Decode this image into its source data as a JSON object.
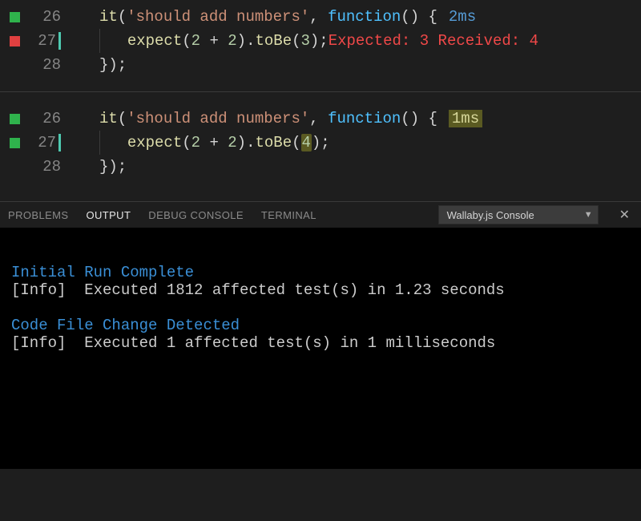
{
  "pane1": {
    "lines": [
      {
        "num": "26",
        "marker": "pass"
      },
      {
        "num": "27",
        "marker": "fail",
        "cursor": true
      },
      {
        "num": "28"
      }
    ],
    "code": {
      "it": "it",
      "testName": "'should add numbers'",
      "comma": ", ",
      "fn": "function",
      "fnTail": "() {",
      "time": "2ms",
      "expect": "expect",
      "expOpen": "(",
      "n1": "2",
      "plus": " + ",
      "n2": "2",
      "expClose": ").",
      "toBe": "toBe",
      "tbOpen": "(",
      "arg": "3",
      "tbClose": ");",
      "err1": "Expected: ",
      "errE": "3",
      "err2": " Received: ",
      "errR": "4",
      "close": "});"
    }
  },
  "pane2": {
    "lines": [
      {
        "num": "26",
        "marker": "pass"
      },
      {
        "num": "27",
        "marker": "pass",
        "cursor": true
      },
      {
        "num": "28"
      }
    ],
    "code": {
      "it": "it",
      "testName": "'should add numbers'",
      "comma": ", ",
      "fn": "function",
      "fnTail": "() {",
      "time": "1ms",
      "expect": "expect",
      "expOpen": "(",
      "n1": "2",
      "plus": " + ",
      "n2": "2",
      "expClose": ").",
      "toBe": "toBe",
      "tbOpen": "(",
      "arg": "4",
      "tbClose": ");",
      "close": "});"
    }
  },
  "panel": {
    "tabs": {
      "problems": "PROBLEMS",
      "output": "OUTPUT",
      "debug": "DEBUG CONSOLE",
      "terminal": "TERMINAL"
    },
    "dropdown": "Wallaby.js Console",
    "close": "✕"
  },
  "console": {
    "h1": "Initial Run Complete",
    "l1a": "[Info]",
    "l1b": "  Executed 1812 affected test(s) in 1.23 seconds",
    "blank": "",
    "h2": "Code File Change Detected",
    "l2a": "[Info]",
    "l2b": "  Executed 1 affected test(s) in 1 milliseconds"
  }
}
